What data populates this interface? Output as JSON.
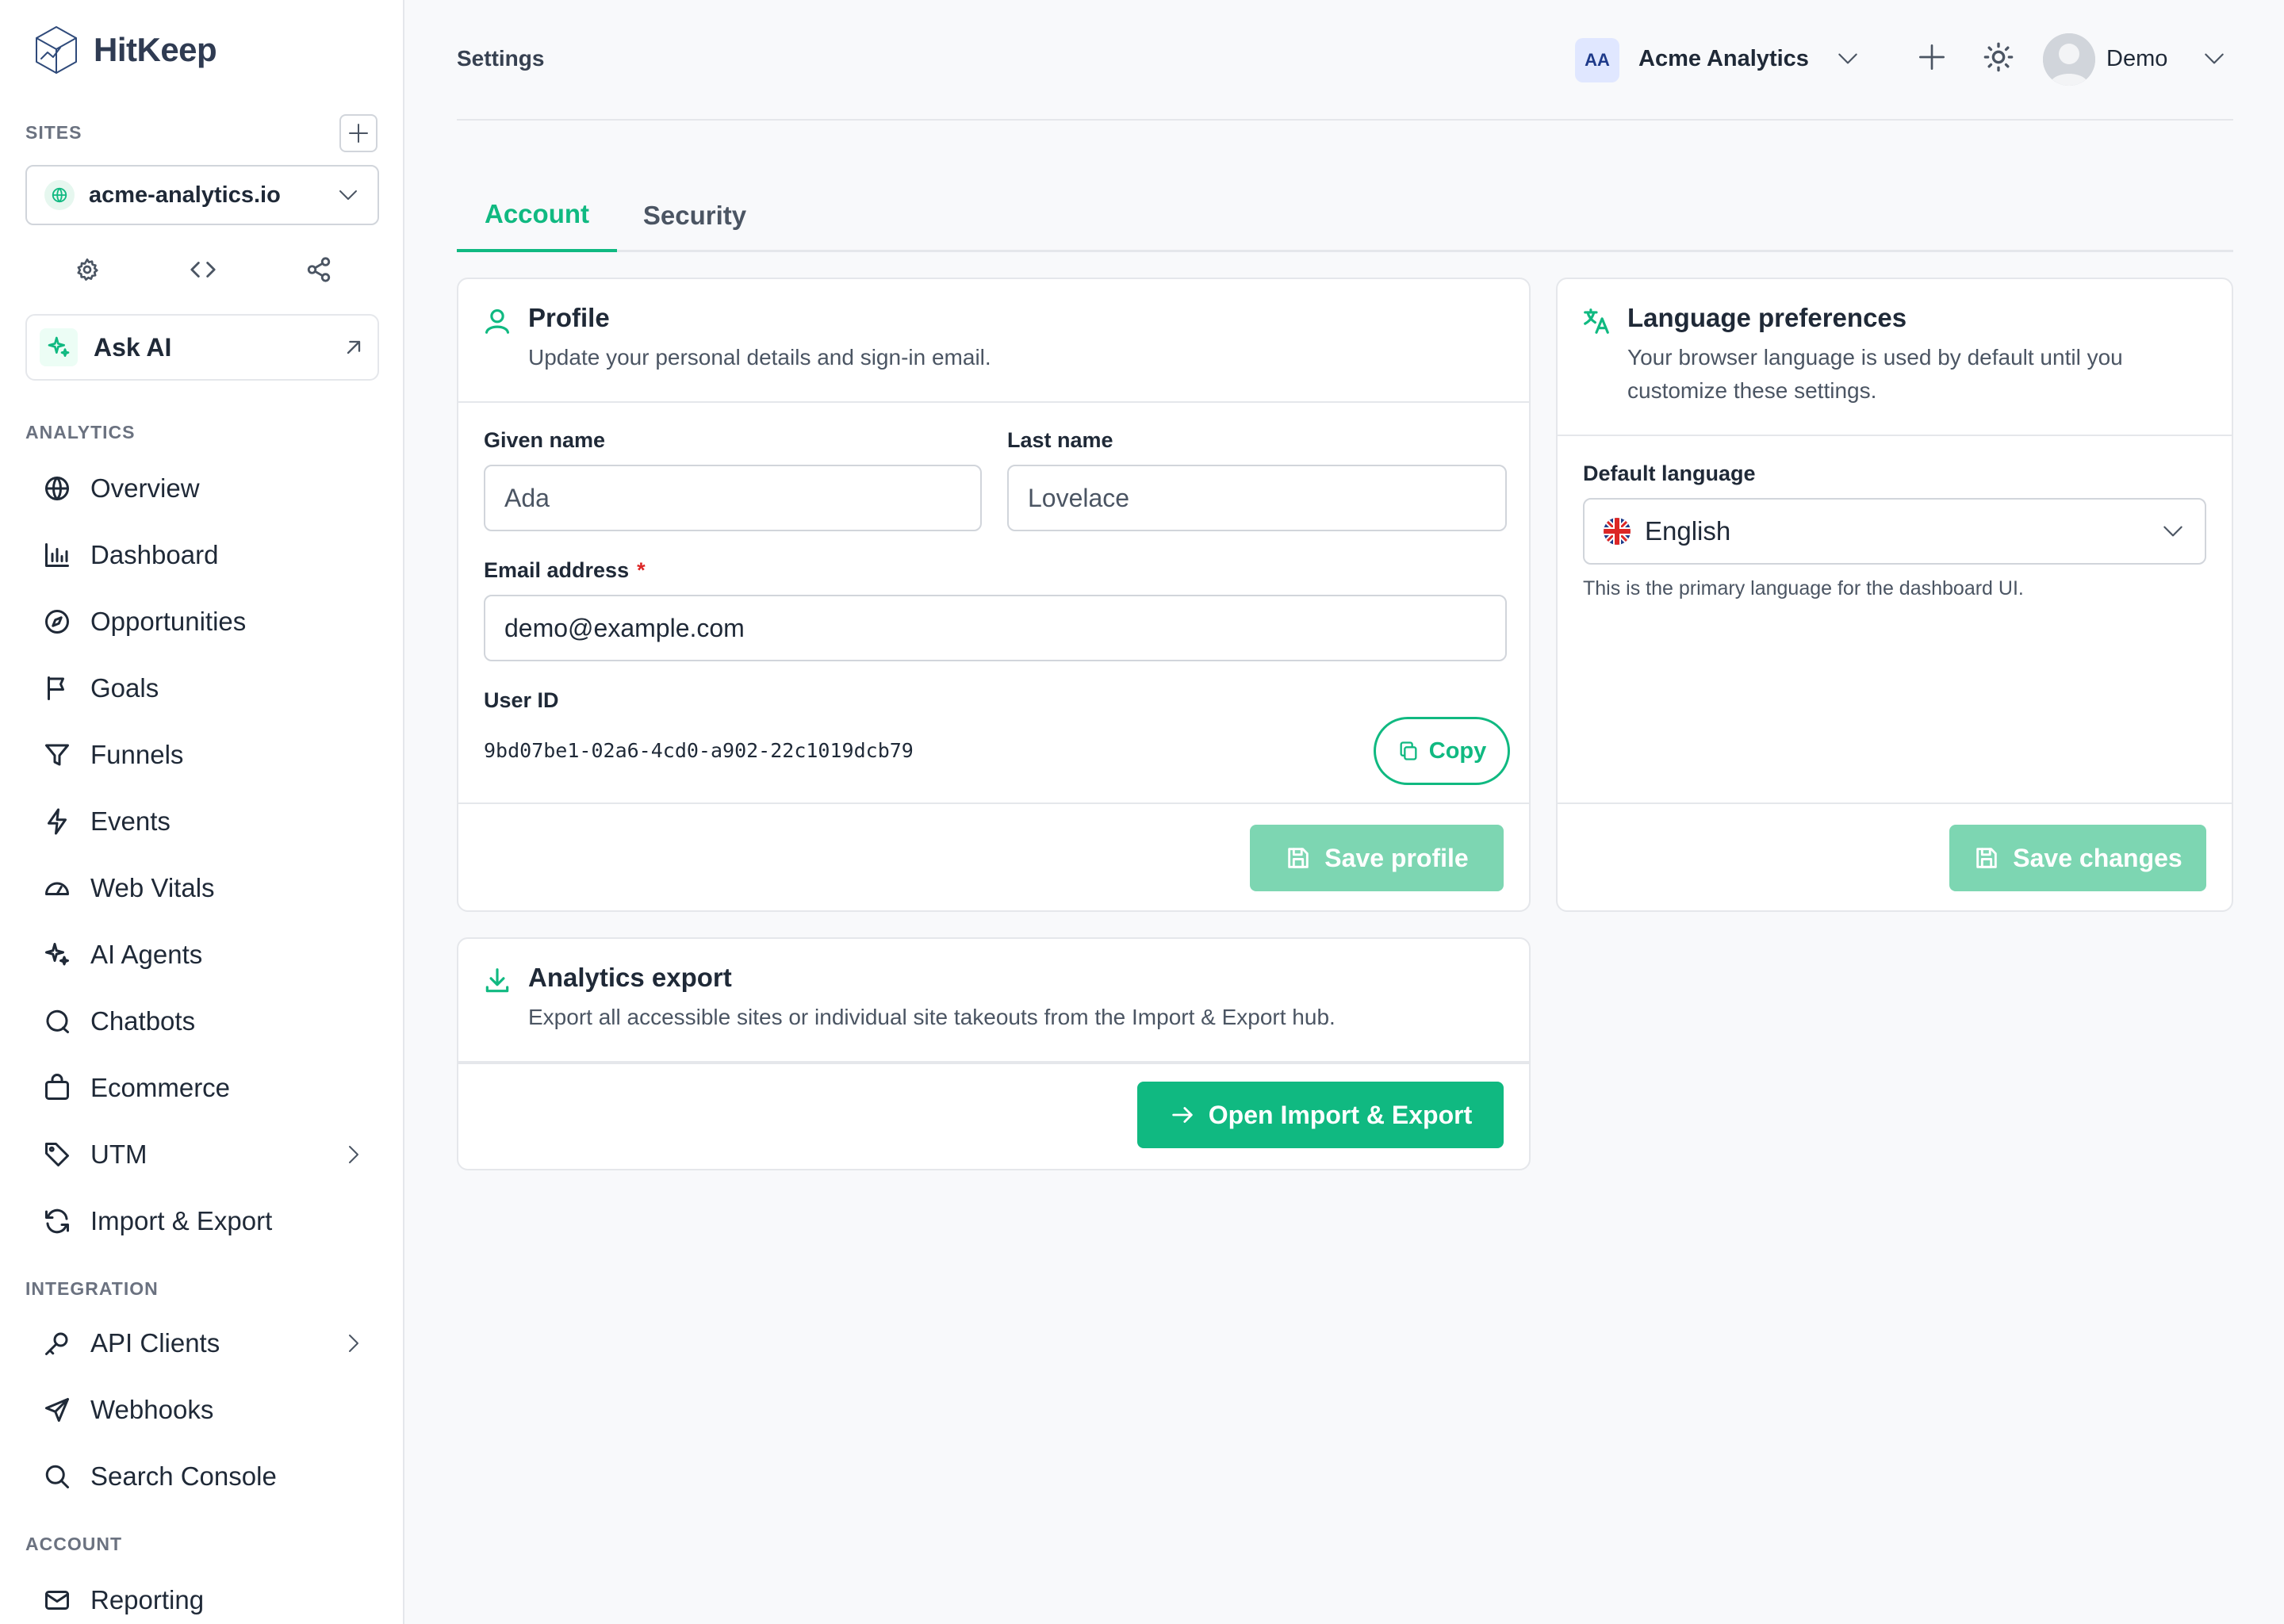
{
  "app": {
    "name": "HitKeep",
    "logo_icon": "cube-logo-icon"
  },
  "sidebar": {
    "sites_label": "SITES",
    "current_site": "acme-analytics.io",
    "ask_ai_label": "Ask AI",
    "analytics_label": "ANALYTICS",
    "analytics_items": [
      {
        "label": "Overview",
        "icon": "globe-icon"
      },
      {
        "label": "Dashboard",
        "icon": "bar-chart-icon"
      },
      {
        "label": "Opportunities",
        "icon": "compass-icon"
      },
      {
        "label": "Goals",
        "icon": "flag-icon"
      },
      {
        "label": "Funnels",
        "icon": "funnel-icon"
      },
      {
        "label": "Events",
        "icon": "bolt-icon"
      },
      {
        "label": "Web Vitals",
        "icon": "gauge-icon"
      },
      {
        "label": "AI Agents",
        "icon": "sparkles-icon"
      },
      {
        "label": "Chatbots",
        "icon": "chat-icon"
      },
      {
        "label": "Ecommerce",
        "icon": "shopping-bag-icon"
      },
      {
        "label": "UTM",
        "icon": "tag-icon"
      },
      {
        "label": "Import & Export",
        "icon": "refresh-icon"
      }
    ],
    "integration_label": "INTEGRATION",
    "integration_items": [
      {
        "label": "API Clients",
        "icon": "key-icon"
      },
      {
        "label": "Webhooks",
        "icon": "send-icon"
      },
      {
        "label": "Search Console",
        "icon": "search-icon"
      }
    ],
    "account_label": "ACCOUNT",
    "account_items": [
      {
        "label": "Reporting",
        "icon": "mail-icon"
      }
    ]
  },
  "header": {
    "title": "Settings",
    "org_initials": "AA",
    "org_name": "Acme Analytics",
    "user_name": "Demo"
  },
  "tabs": [
    {
      "label": "Account",
      "active": true
    },
    {
      "label": "Security",
      "active": false
    }
  ],
  "profile": {
    "title": "Profile",
    "description": "Update your personal details and sign-in email.",
    "given_name_label": "Given name",
    "given_name_placeholder": "Ada",
    "last_name_label": "Last name",
    "last_name_placeholder": "Lovelace",
    "email_label": "Email address",
    "email_required_mark": "*",
    "email_value": "demo@example.com",
    "user_id_label": "User ID",
    "user_id_value": "9bd07be1-02a6-4cd0-a902-22c1019dcb79",
    "copy_label": "Copy",
    "save_label": "Save profile"
  },
  "language": {
    "title": "Language preferences",
    "description_line1": "Your browser language is used by default until you",
    "description_line2": "customize these settings.",
    "default_language_label": "Default language",
    "selected_language": "English",
    "hint": "This is the primary language for the dashboard UI.",
    "save_label": "Save changes"
  },
  "export": {
    "title": "Analytics export",
    "description": "Export all accessible sites or individual site takeouts from the Import & Export hub.",
    "button_label": "Open Import & Export"
  },
  "colors": {
    "accent": "#10b981",
    "accent_disabled": "#7dd6b2",
    "logo": "#2f4a7a",
    "required": "#dc2626"
  }
}
